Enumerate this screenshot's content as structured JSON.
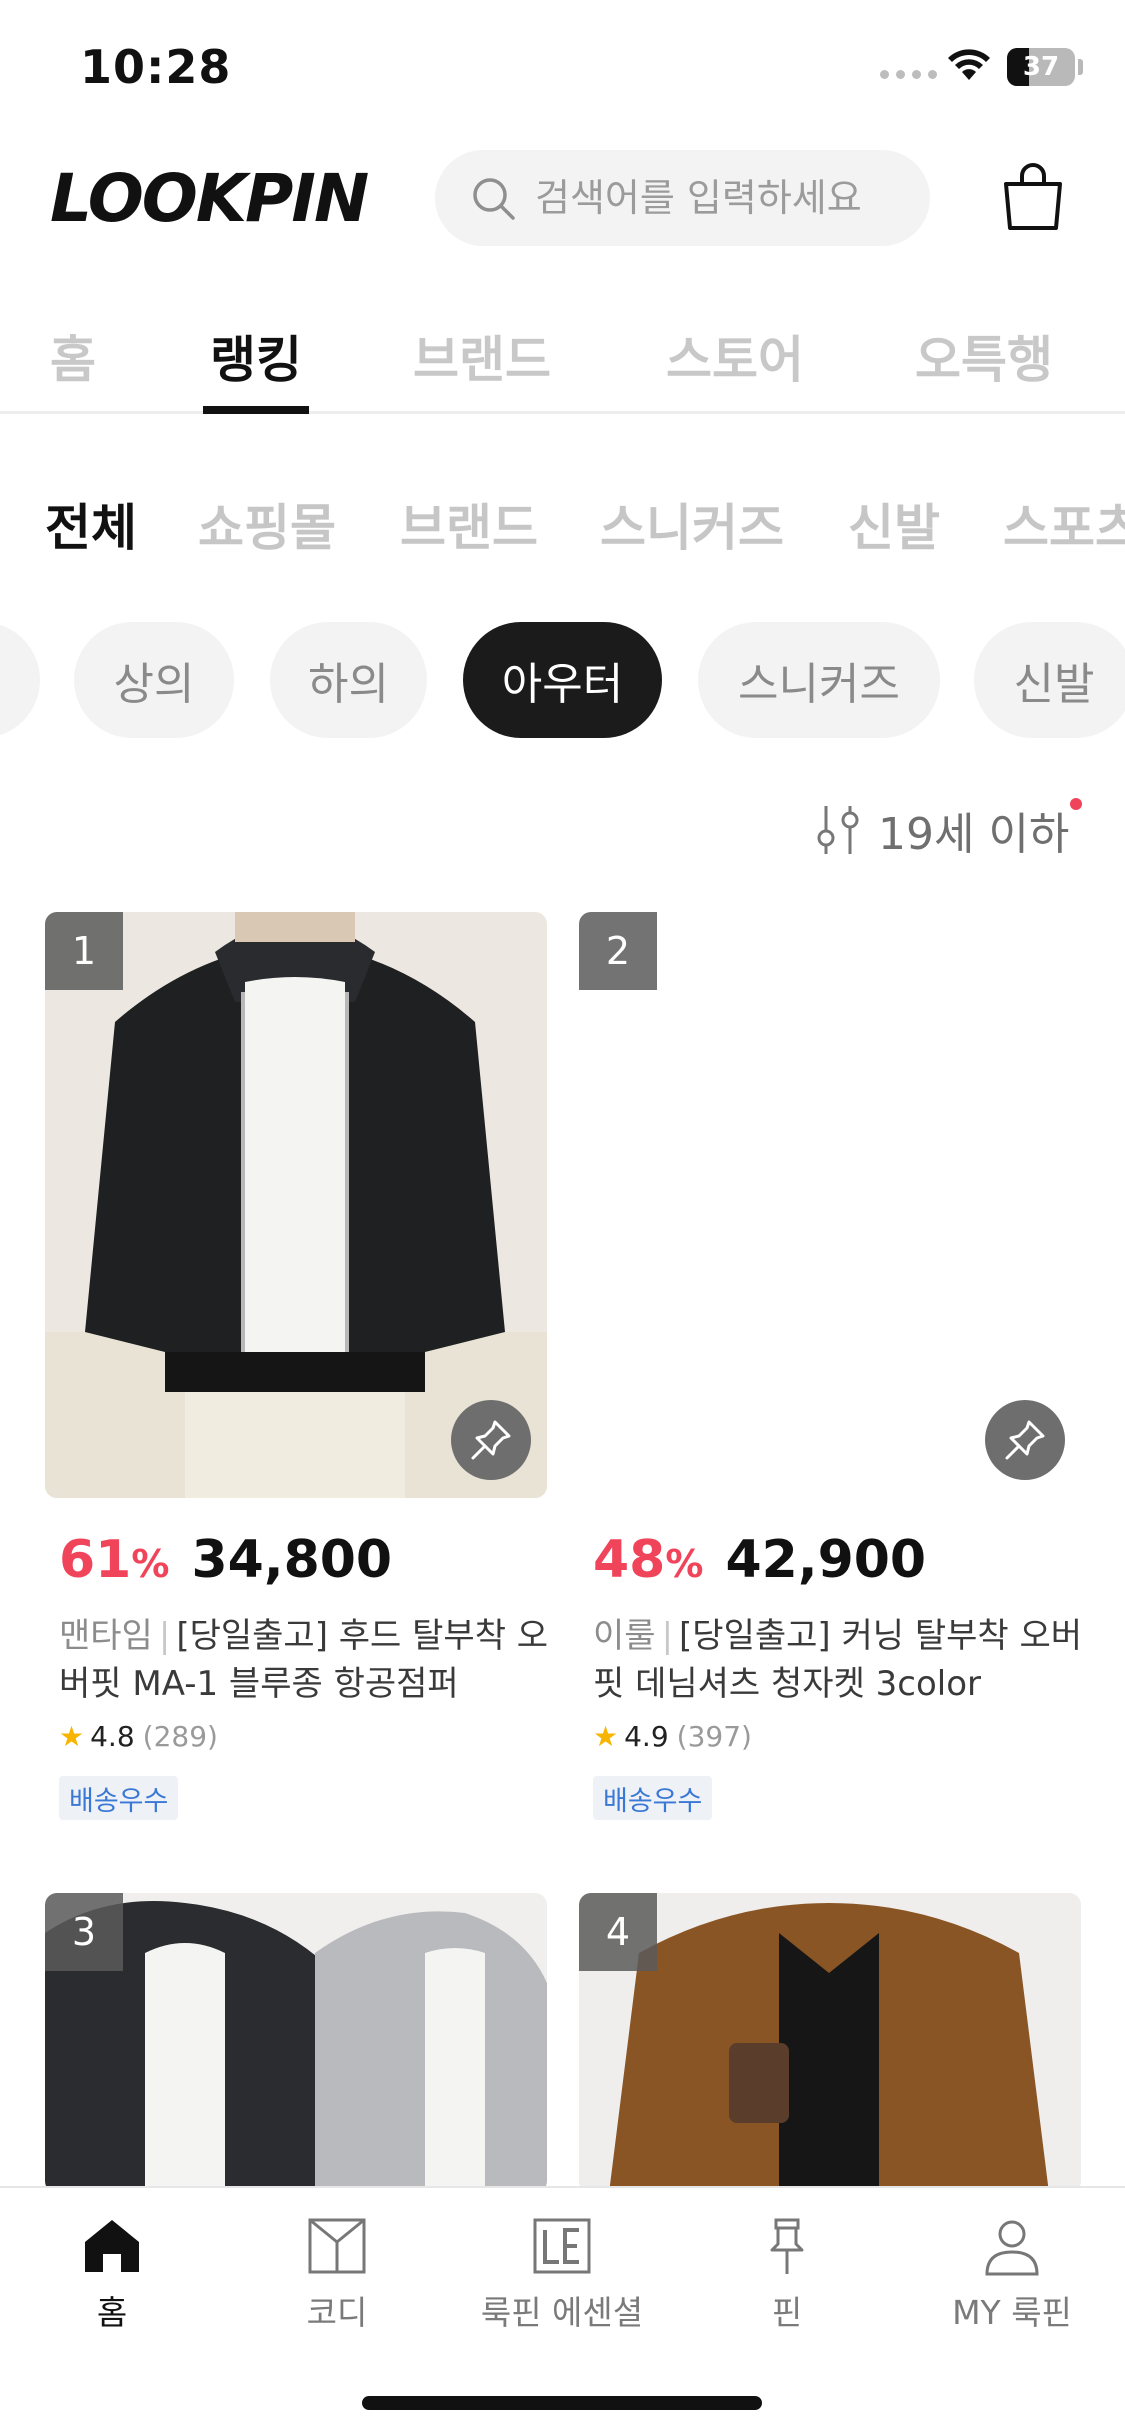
{
  "status_bar": {
    "time": "10:28",
    "battery": "37"
  },
  "header": {
    "logo": "LOOKPIN",
    "search_placeholder": "검색어를 입력하세요"
  },
  "top_tabs": [
    {
      "label": "홈",
      "active": false
    },
    {
      "label": "랭킹",
      "active": true
    },
    {
      "label": "브랜드",
      "active": false
    },
    {
      "label": "스토어",
      "active": false
    },
    {
      "label": "오특행",
      "active": false
    }
  ],
  "sub_tabs": [
    {
      "label": "전체",
      "active": true
    },
    {
      "label": "쇼핑몰",
      "active": false
    },
    {
      "label": "브랜드",
      "active": false
    },
    {
      "label": "스니커즈",
      "active": false
    },
    {
      "label": "신발",
      "active": false
    },
    {
      "label": "스포츠",
      "active": false
    }
  ],
  "chips": [
    {
      "label": "",
      "active": false
    },
    {
      "label": "상의",
      "active": false
    },
    {
      "label": "하의",
      "active": false
    },
    {
      "label": "아우터",
      "active": true
    },
    {
      "label": "스니커즈",
      "active": false
    },
    {
      "label": "신발",
      "active": false
    }
  ],
  "filter": {
    "label": "19세 이하",
    "icon": "filter-sliders-icon",
    "has_dot": true
  },
  "products": [
    {
      "rank": "1",
      "discount": "61",
      "percent_sign": "%",
      "price": "34,800",
      "brand": "맨타임",
      "separator": "|",
      "title": "[당일출고] 후드 탈부착 오버핏 MA-1 블루종 항공점퍼",
      "rating": "4.8",
      "reviews": "(289)",
      "badge": "배송우수"
    },
    {
      "rank": "2",
      "discount": "48",
      "percent_sign": "%",
      "price": "42,900",
      "brand": "이룰",
      "separator": "|",
      "title": "[당일출고] 커닝 탈부착 오버핏 데님셔츠 청자켓 3color",
      "rating": "4.9",
      "reviews": "(397)",
      "badge": "배송우수"
    },
    {
      "rank": "3"
    },
    {
      "rank": "4"
    }
  ],
  "bottom_nav": [
    {
      "label": "홈",
      "icon": "home-icon",
      "active": true
    },
    {
      "label": "코디",
      "icon": "codi-shirt-icon",
      "active": false
    },
    {
      "label": "룩핀 에센셜",
      "icon": "le-essential-icon",
      "active": false
    },
    {
      "label": "핀",
      "icon": "pin-icon",
      "active": false
    },
    {
      "label": "MY 룩핀",
      "icon": "person-icon",
      "active": false
    }
  ],
  "colors": {
    "accent_red": "#f0445b",
    "badge_blue": "#3a78d6",
    "active_dark": "#1b1b1b"
  }
}
